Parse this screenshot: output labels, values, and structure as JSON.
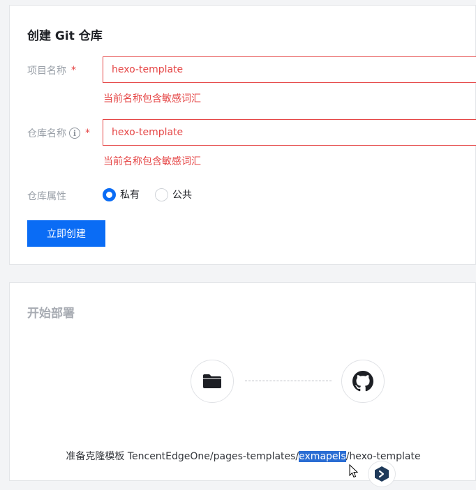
{
  "create": {
    "title": "创建 Git 仓库",
    "project_name": {
      "label": "项目名称",
      "required_mark": "*",
      "value": "hexo-template",
      "error": "当前名称包含敏感词汇"
    },
    "repo_name": {
      "label": "仓库名称",
      "info_glyph": "i",
      "required_mark": "*",
      "value": "hexo-template",
      "error": "当前名称包含敏感词汇"
    },
    "repo_visibility": {
      "label": "仓库属性",
      "options": [
        "私有",
        "公共"
      ],
      "selected": "私有"
    },
    "submit_label": "立即创建"
  },
  "deploy": {
    "title": "开始部署",
    "clone_prefix": "准备克隆模板 TencentEdgeOne/pages-templates/",
    "clone_highlight": "exmapels",
    "clone_suffix": "/hexo-template",
    "icons": [
      "folder-icon",
      "github-icon"
    ]
  },
  "colors": {
    "accent": "#0a6cf5",
    "error": "#e54545",
    "selection": "#2a6dd3"
  }
}
